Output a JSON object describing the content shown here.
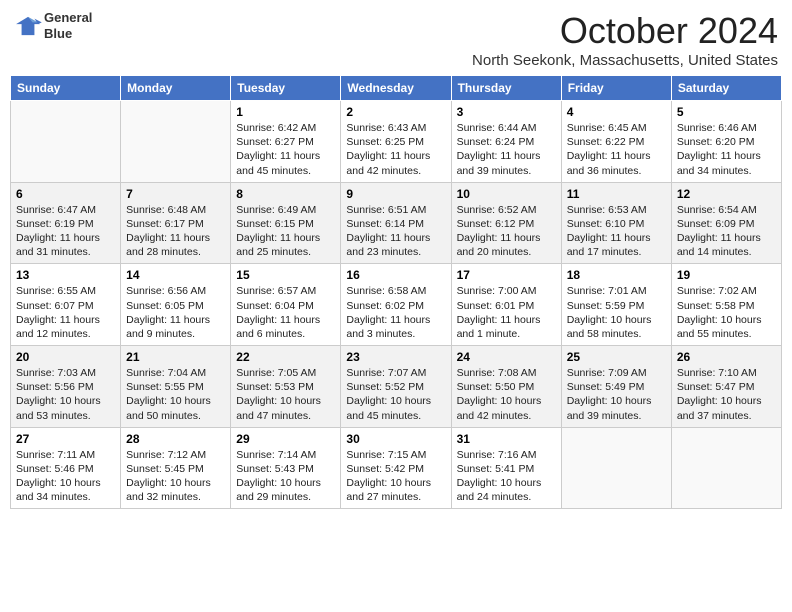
{
  "header": {
    "logo_line1": "General",
    "logo_line2": "Blue",
    "month_title": "October 2024",
    "location": "North Seekonk, Massachusetts, United States"
  },
  "weekdays": [
    "Sunday",
    "Monday",
    "Tuesday",
    "Wednesday",
    "Thursday",
    "Friday",
    "Saturday"
  ],
  "weeks": [
    [
      {
        "day": "",
        "sunrise": "",
        "sunset": "",
        "daylight": ""
      },
      {
        "day": "",
        "sunrise": "",
        "sunset": "",
        "daylight": ""
      },
      {
        "day": "1",
        "sunrise": "Sunrise: 6:42 AM",
        "sunset": "Sunset: 6:27 PM",
        "daylight": "Daylight: 11 hours and 45 minutes."
      },
      {
        "day": "2",
        "sunrise": "Sunrise: 6:43 AM",
        "sunset": "Sunset: 6:25 PM",
        "daylight": "Daylight: 11 hours and 42 minutes."
      },
      {
        "day": "3",
        "sunrise": "Sunrise: 6:44 AM",
        "sunset": "Sunset: 6:24 PM",
        "daylight": "Daylight: 11 hours and 39 minutes."
      },
      {
        "day": "4",
        "sunrise": "Sunrise: 6:45 AM",
        "sunset": "Sunset: 6:22 PM",
        "daylight": "Daylight: 11 hours and 36 minutes."
      },
      {
        "day": "5",
        "sunrise": "Sunrise: 6:46 AM",
        "sunset": "Sunset: 6:20 PM",
        "daylight": "Daylight: 11 hours and 34 minutes."
      }
    ],
    [
      {
        "day": "6",
        "sunrise": "Sunrise: 6:47 AM",
        "sunset": "Sunset: 6:19 PM",
        "daylight": "Daylight: 11 hours and 31 minutes."
      },
      {
        "day": "7",
        "sunrise": "Sunrise: 6:48 AM",
        "sunset": "Sunset: 6:17 PM",
        "daylight": "Daylight: 11 hours and 28 minutes."
      },
      {
        "day": "8",
        "sunrise": "Sunrise: 6:49 AM",
        "sunset": "Sunset: 6:15 PM",
        "daylight": "Daylight: 11 hours and 25 minutes."
      },
      {
        "day": "9",
        "sunrise": "Sunrise: 6:51 AM",
        "sunset": "Sunset: 6:14 PM",
        "daylight": "Daylight: 11 hours and 23 minutes."
      },
      {
        "day": "10",
        "sunrise": "Sunrise: 6:52 AM",
        "sunset": "Sunset: 6:12 PM",
        "daylight": "Daylight: 11 hours and 20 minutes."
      },
      {
        "day": "11",
        "sunrise": "Sunrise: 6:53 AM",
        "sunset": "Sunset: 6:10 PM",
        "daylight": "Daylight: 11 hours and 17 minutes."
      },
      {
        "day": "12",
        "sunrise": "Sunrise: 6:54 AM",
        "sunset": "Sunset: 6:09 PM",
        "daylight": "Daylight: 11 hours and 14 minutes."
      }
    ],
    [
      {
        "day": "13",
        "sunrise": "Sunrise: 6:55 AM",
        "sunset": "Sunset: 6:07 PM",
        "daylight": "Daylight: 11 hours and 12 minutes."
      },
      {
        "day": "14",
        "sunrise": "Sunrise: 6:56 AM",
        "sunset": "Sunset: 6:05 PM",
        "daylight": "Daylight: 11 hours and 9 minutes."
      },
      {
        "day": "15",
        "sunrise": "Sunrise: 6:57 AM",
        "sunset": "Sunset: 6:04 PM",
        "daylight": "Daylight: 11 hours and 6 minutes."
      },
      {
        "day": "16",
        "sunrise": "Sunrise: 6:58 AM",
        "sunset": "Sunset: 6:02 PM",
        "daylight": "Daylight: 11 hours and 3 minutes."
      },
      {
        "day": "17",
        "sunrise": "Sunrise: 7:00 AM",
        "sunset": "Sunset: 6:01 PM",
        "daylight": "Daylight: 11 hours and 1 minute."
      },
      {
        "day": "18",
        "sunrise": "Sunrise: 7:01 AM",
        "sunset": "Sunset: 5:59 PM",
        "daylight": "Daylight: 10 hours and 58 minutes."
      },
      {
        "day": "19",
        "sunrise": "Sunrise: 7:02 AM",
        "sunset": "Sunset: 5:58 PM",
        "daylight": "Daylight: 10 hours and 55 minutes."
      }
    ],
    [
      {
        "day": "20",
        "sunrise": "Sunrise: 7:03 AM",
        "sunset": "Sunset: 5:56 PM",
        "daylight": "Daylight: 10 hours and 53 minutes."
      },
      {
        "day": "21",
        "sunrise": "Sunrise: 7:04 AM",
        "sunset": "Sunset: 5:55 PM",
        "daylight": "Daylight: 10 hours and 50 minutes."
      },
      {
        "day": "22",
        "sunrise": "Sunrise: 7:05 AM",
        "sunset": "Sunset: 5:53 PM",
        "daylight": "Daylight: 10 hours and 47 minutes."
      },
      {
        "day": "23",
        "sunrise": "Sunrise: 7:07 AM",
        "sunset": "Sunset: 5:52 PM",
        "daylight": "Daylight: 10 hours and 45 minutes."
      },
      {
        "day": "24",
        "sunrise": "Sunrise: 7:08 AM",
        "sunset": "Sunset: 5:50 PM",
        "daylight": "Daylight: 10 hours and 42 minutes."
      },
      {
        "day": "25",
        "sunrise": "Sunrise: 7:09 AM",
        "sunset": "Sunset: 5:49 PM",
        "daylight": "Daylight: 10 hours and 39 minutes."
      },
      {
        "day": "26",
        "sunrise": "Sunrise: 7:10 AM",
        "sunset": "Sunset: 5:47 PM",
        "daylight": "Daylight: 10 hours and 37 minutes."
      }
    ],
    [
      {
        "day": "27",
        "sunrise": "Sunrise: 7:11 AM",
        "sunset": "Sunset: 5:46 PM",
        "daylight": "Daylight: 10 hours and 34 minutes."
      },
      {
        "day": "28",
        "sunrise": "Sunrise: 7:12 AM",
        "sunset": "Sunset: 5:45 PM",
        "daylight": "Daylight: 10 hours and 32 minutes."
      },
      {
        "day": "29",
        "sunrise": "Sunrise: 7:14 AM",
        "sunset": "Sunset: 5:43 PM",
        "daylight": "Daylight: 10 hours and 29 minutes."
      },
      {
        "day": "30",
        "sunrise": "Sunrise: 7:15 AM",
        "sunset": "Sunset: 5:42 PM",
        "daylight": "Daylight: 10 hours and 27 minutes."
      },
      {
        "day": "31",
        "sunrise": "Sunrise: 7:16 AM",
        "sunset": "Sunset: 5:41 PM",
        "daylight": "Daylight: 10 hours and 24 minutes."
      },
      {
        "day": "",
        "sunrise": "",
        "sunset": "",
        "daylight": ""
      },
      {
        "day": "",
        "sunrise": "",
        "sunset": "",
        "daylight": ""
      }
    ]
  ]
}
